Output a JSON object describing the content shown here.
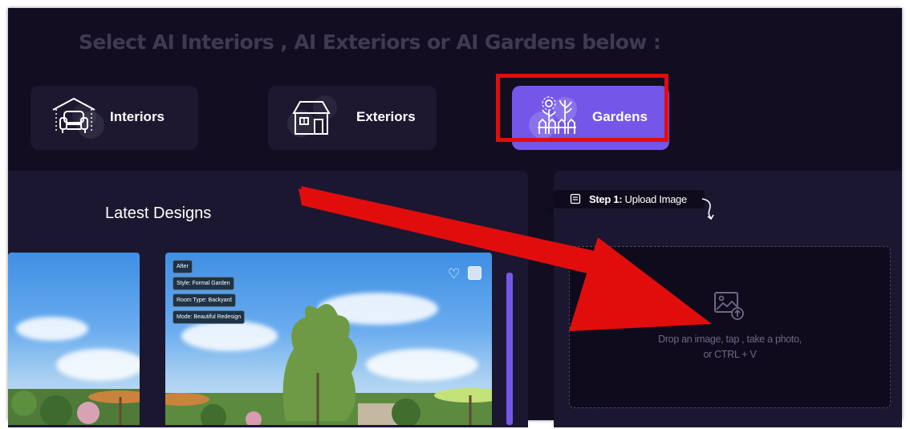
{
  "heading": "Select AI Interiors , AI Exteriors or AI Gardens below :",
  "categories": [
    {
      "label": "Interiors",
      "icon": "armchair-icon",
      "selected": false
    },
    {
      "label": "Exteriors",
      "icon": "house-icon",
      "selected": false
    },
    {
      "label": "Gardens",
      "icon": "garden-flowers-icon",
      "selected": true
    }
  ],
  "colors": {
    "accent": "#7457e9",
    "background": "#120d21",
    "panel": "#1c1730",
    "annotation_red": "#e10d0d"
  },
  "latest_designs": {
    "title": "Latest Designs",
    "card": {
      "tags": [
        "After",
        "Style: Formal Garden",
        "Room Type: Backyard",
        "Mode: Beautiful Redesign"
      ]
    }
  },
  "upload": {
    "step_label": "Step 1:",
    "step_text": " Upload Image",
    "drop_line1": "Drop an image, tap , take a photo,",
    "drop_line2": "or CTRL + V"
  }
}
